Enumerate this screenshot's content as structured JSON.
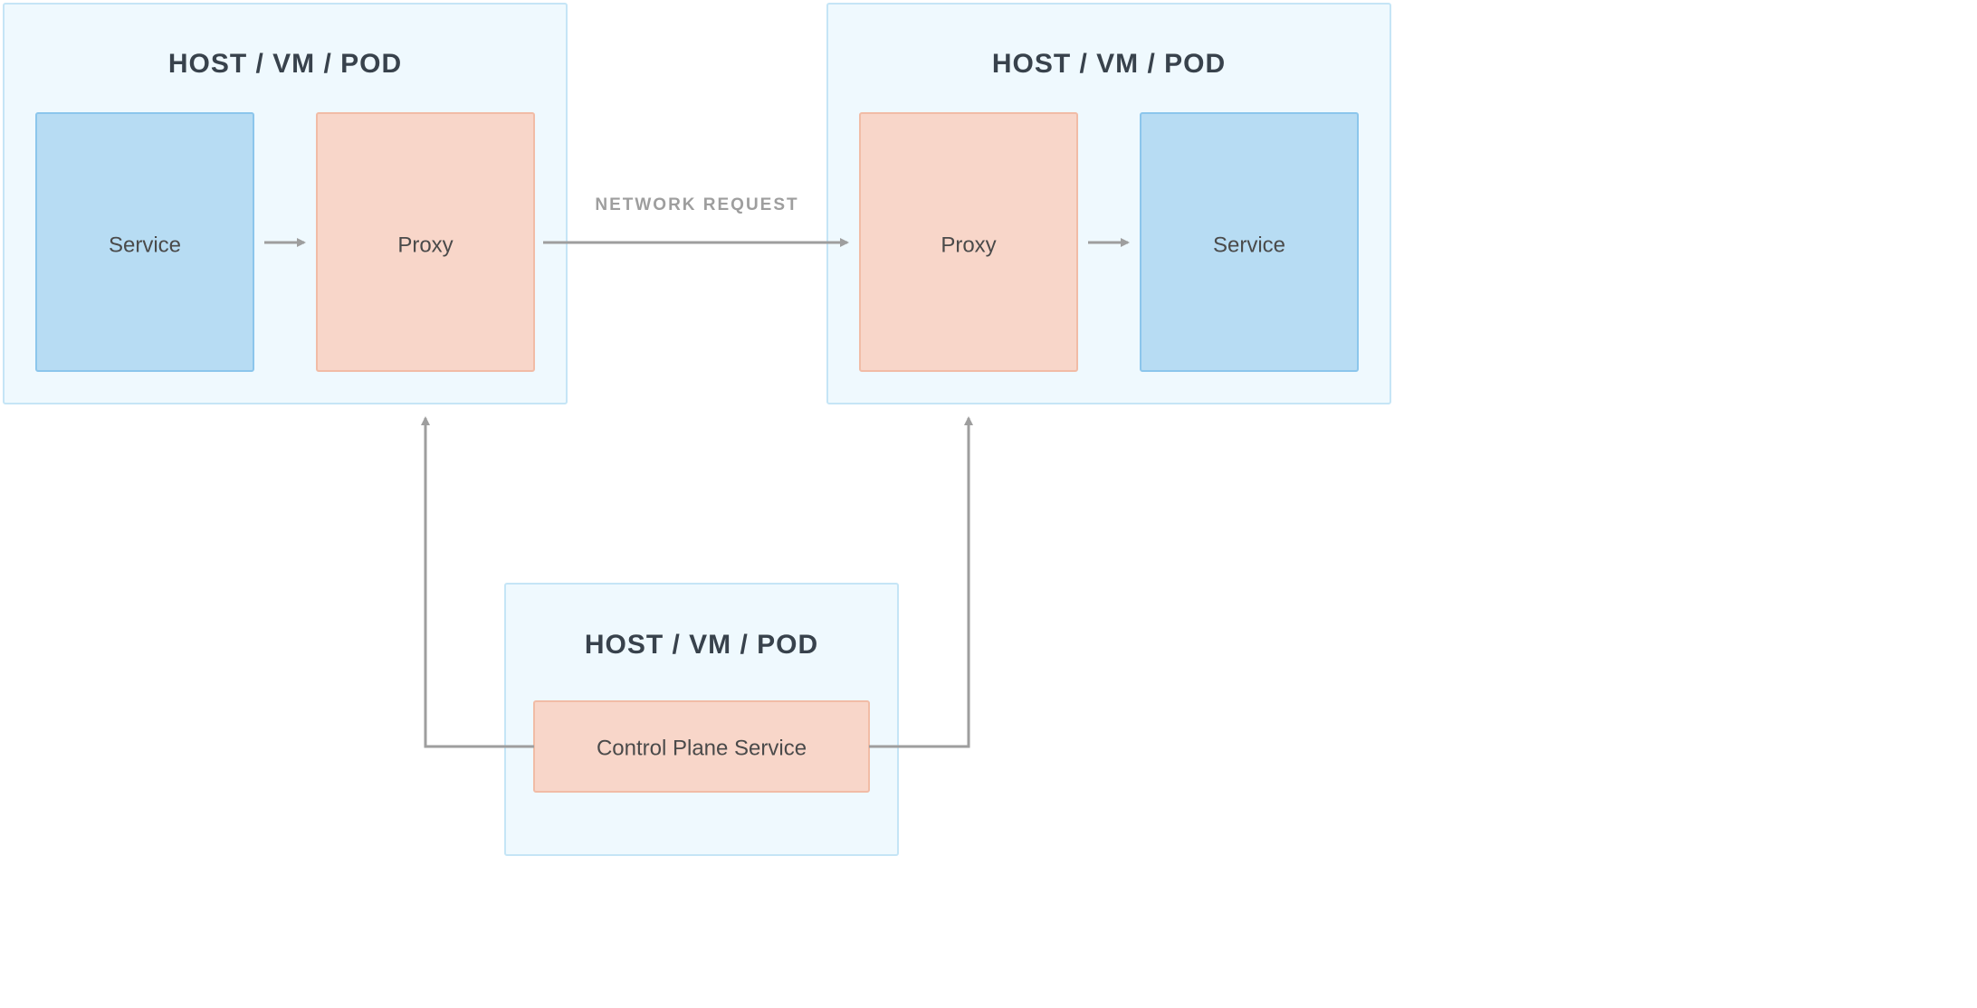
{
  "hosts": {
    "left": {
      "title": "HOST / VM / POD",
      "service": "Service",
      "proxy": "Proxy"
    },
    "right": {
      "title": "HOST / VM / POD",
      "service": "Service",
      "proxy": "Proxy"
    },
    "bottom": {
      "title": "HOST / VM / POD",
      "control": "Control Plane Service"
    }
  },
  "labels": {
    "network_request": "NETWORK REQUEST"
  },
  "colors": {
    "host_fill": "#eff9fe",
    "host_stroke": "#c5e5f6",
    "service_fill": "#b7dcf3",
    "service_stroke": "#8cc6ec",
    "proxy_fill": "#f8d6c9",
    "proxy_stroke": "#f1bca6",
    "arrow": "#9e9e9e",
    "text_dark": "#38424c"
  }
}
